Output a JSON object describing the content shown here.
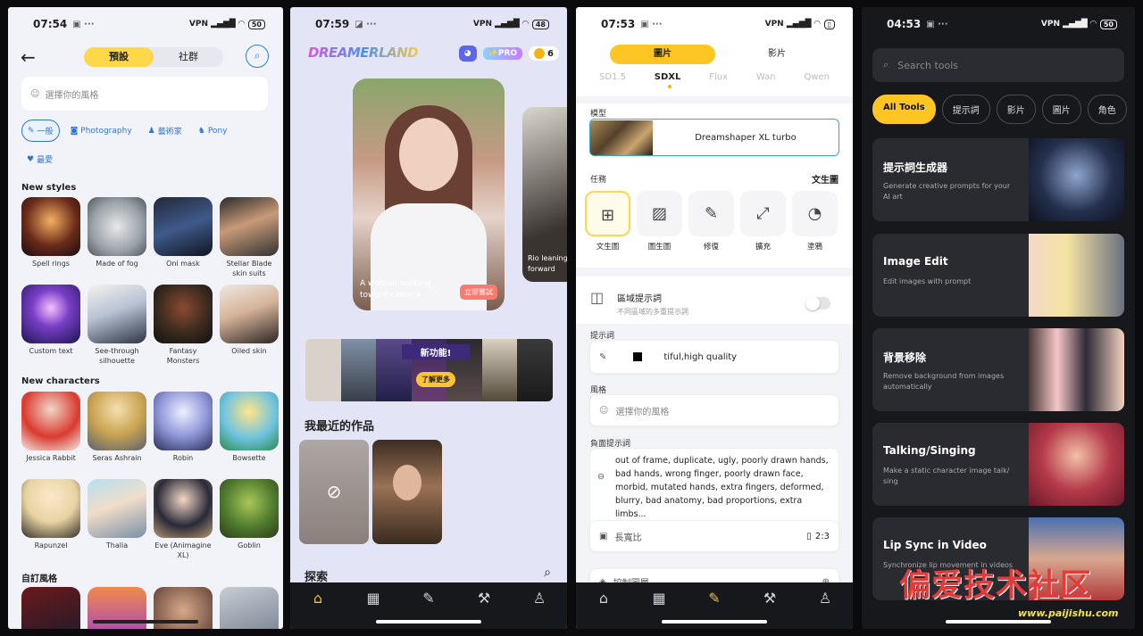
{
  "p1": {
    "time": "07:54",
    "battery": "50",
    "tabs": [
      "預設",
      "社群"
    ],
    "search_placeholder": "選擇你的風格",
    "chips": [
      "一般",
      "Photography",
      "藝術家",
      "Pony",
      "最愛"
    ],
    "sections": [
      "New styles",
      "New characters",
      "自訂風格"
    ],
    "new_styles": [
      "Spell rings",
      "Made of fog",
      "Oni mask",
      "Stellar Blade skin suits",
      "Custom text",
      "See-through silhouette",
      "Fantasy Monsters",
      "Oiled skin"
    ],
    "new_characters": [
      "Jessica Rabbit",
      "Seras Ashrain",
      "Robin",
      "Bowsette",
      "Rapunzel",
      "Thalia",
      "Eve (Animagine XL)",
      "Goblin"
    ]
  },
  "p2": {
    "time": "07:59",
    "battery": "48",
    "logo": "DREAMERLAND",
    "pro": "✨PRO",
    "coins": "6",
    "hero_caption": "A woman walking toward camera",
    "hero_button": "立即嘗試",
    "hero2_caption": "Rio leaning forward",
    "banner_new": "新功能!",
    "banner_more": "了解更多",
    "recent": "我最近的作品",
    "explore": "探索"
  },
  "p3": {
    "time": "07:53",
    "tabs": [
      "圖片",
      "影片"
    ],
    "models": [
      "SD1.5",
      "SDXL",
      "Flux",
      "Wan",
      "Qwen"
    ],
    "model_label": "模型",
    "model_name": "Dreamshaper XL turbo",
    "task_label": "任務",
    "task_current": "文生圖",
    "tasks": [
      "文生圖",
      "圖生圖",
      "修復",
      "擴充",
      "塗鴉"
    ],
    "region_title": "區域提示詞",
    "region_sub": "不同區域的多重提示詞",
    "prompt_label": "提示詞",
    "prompt_text": "tiful,high quality",
    "style_label": "風格",
    "style_placeholder": "選擇你的風格",
    "neg_label": "負面提示詞",
    "neg_text": "out of frame, duplicate, ugly, poorly drawn hands, bad hands, wrong finger, poorly drawn face, morbid, mutated hands, extra fingers, deformed, blurry, bad anatomy, bad proportions, extra limbs...",
    "ratio_label": "長寬比",
    "ratio_value": "2:3",
    "control_label": "控制圖層"
  },
  "p4": {
    "time": "04:53",
    "battery": "50",
    "search_placeholder": "Search tools",
    "tabs": [
      "All Tools",
      "提示詞",
      "影片",
      "圖片",
      "角色"
    ],
    "cards": [
      {
        "title": "提示詞生成器",
        "desc": "Generate creative prompts for your AI art"
      },
      {
        "title": "Image Edit",
        "desc": "Edit images with prompt"
      },
      {
        "title": "背景移除",
        "desc": "Remove background from images automatically"
      },
      {
        "title": "Talking/Singing",
        "desc": "Make a static character image talk/ sing"
      },
      {
        "title": "Lip Sync in Video",
        "desc": "Synchronize lip movement in videos"
      }
    ]
  },
  "watermark": "偏爱技术社区",
  "watermark_url": "www.paijishu.com"
}
